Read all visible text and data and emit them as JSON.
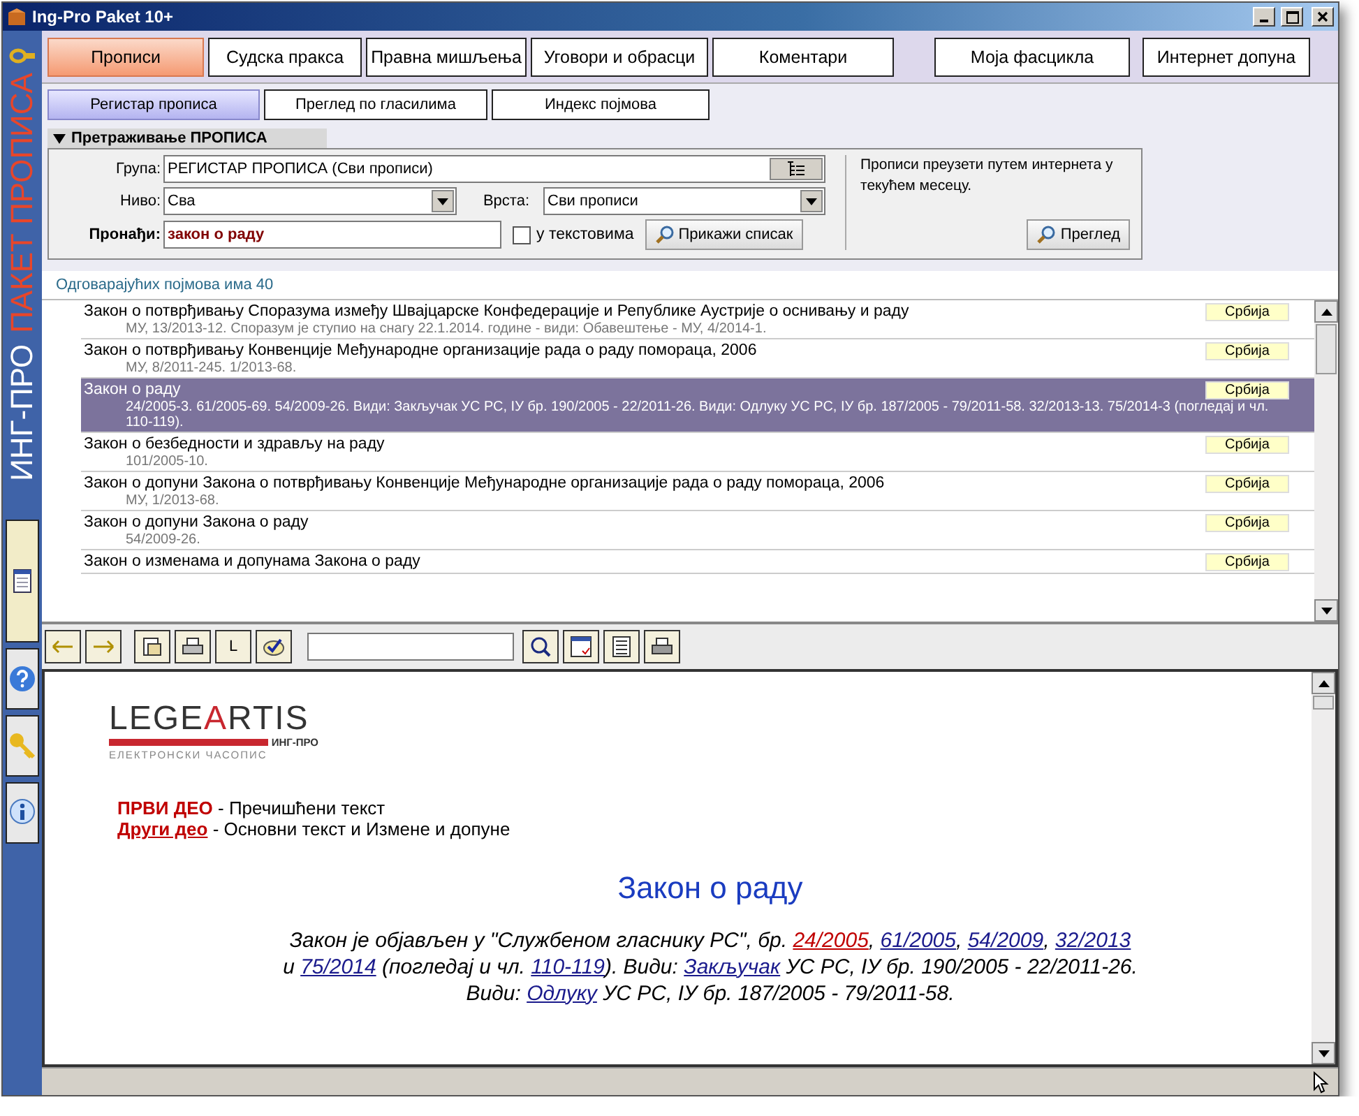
{
  "window": {
    "title": "Ing-Pro Paket 10+"
  },
  "brand": {
    "part_1": "ИНГ-ПРО",
    "part_2": "ПАКЕТ ПРОПИСА"
  },
  "tabs": [
    {
      "label": "Прописи",
      "selected": true
    },
    {
      "label": "Судска пракса",
      "selected": false
    },
    {
      "label": "Правна мишљења",
      "selected": false
    },
    {
      "label": "Уговори и обрасци",
      "selected": false
    },
    {
      "label": "Коментари",
      "selected": false
    },
    {
      "label": "Моја фасцикла",
      "selected": false
    },
    {
      "label": "Интернет допуна",
      "selected": false
    }
  ],
  "subtabs": [
    {
      "label": "Регистар прописа",
      "selected": true
    },
    {
      "label": "Преглед по гласилима",
      "selected": false
    },
    {
      "label": "Индекс појмова",
      "selected": false
    }
  ],
  "search": {
    "title": "Претраживање ПРОПИСА",
    "expanded": true,
    "group_label": "Група:",
    "group_value": "РЕГИСТАР ПРОПИСА (Сви прописи)",
    "level_label": "Ниво:",
    "level_value": "Сва",
    "type_label": "Врста:",
    "type_value": "Сви прописи",
    "find_label": "Пронађи:",
    "find_value": "закон о раду",
    "in_texts": {
      "label": "у текстовима",
      "checked": false
    },
    "show_button": "Прикажи списак",
    "note": "Прописи преузети путем интернета у текућем месецу.",
    "review_button": "Преглед"
  },
  "count": "Одговарајућих појмова има 40",
  "results": [
    {
      "title": "Закон о потврђивању Споразума између Швајцарске Конфедерације и Републике Аустрије о оснивању и раду",
      "details": "МУ, 13/2013-12. Споразум је ступио на снагу 22.1.2014. године - види: Обавештење - МУ, 4/2014-1.",
      "region": "Србија",
      "selected": false
    },
    {
      "title": "Закон о потврђивању Конвенције Међународне организације рада о раду помораца, 2006",
      "details": "МУ, 8/2011-245. 1/2013-68.",
      "region": "Србија",
      "selected": false
    },
    {
      "title": "Закон о раду",
      "details": "24/2005-3. 61/2005-69. 54/2009-26. Види: Закључак УС РС, IУ бр. 190/2005 - 22/2011-26. Види: Одлуку УС РС, IУ бр. 187/2005 - 79/2011-58. 32/2013-13. 75/2014-3 (погледај и чл. 110-119).",
      "region": "Србија",
      "selected": true
    },
    {
      "title": "Закон о безбедности и здрављу на раду",
      "details": "101/2005-10.",
      "region": "Србија",
      "selected": false
    },
    {
      "title": "Закон о допуни Закона о потврђивању Конвенције Међународне организације рада о раду помораца, 2006",
      "details": "МУ, 1/2013-68.",
      "region": "Србија",
      "selected": false
    },
    {
      "title": "Закон о допуни Закона о раду",
      "details": "54/2009-26.",
      "region": "Србија",
      "selected": false
    },
    {
      "title": "Закон о изменама и допунама Закона о раду",
      "region": "Србија",
      "selected": false
    }
  ],
  "toolbar": {
    "text_button": "L"
  },
  "document": {
    "logo": {
      "word_1": "LEGE",
      "word_2": "A",
      "word_3": "RTIS",
      "sub_1": "ИНГ-ПРО",
      "sub_2": "ЕЛЕКТРОНСКИ ЧАСОПИС"
    },
    "parts": [
      {
        "label": "ПРВИ ДЕО",
        "link": false,
        "desc": " - Пречишћени текст"
      },
      {
        "label": "Други део",
        "link": true,
        "desc": " - Основни текст и Измене и допуне"
      }
    ],
    "title": "Закон о раду",
    "lines": [
      [
        {
          "text": "Закон је објављен у \"Службеном гласнику РС\", бр. "
        },
        {
          "text": "24/2005",
          "link": true,
          "visited": true
        },
        {
          "text": ", "
        },
        {
          "text": "61/2005",
          "link": true,
          "visited": false
        },
        {
          "text": ", "
        },
        {
          "text": "54/2009",
          "link": true,
          "visited": false
        },
        {
          "text": ", "
        },
        {
          "text": "32/2013",
          "link": true,
          "visited": false
        }
      ],
      [
        {
          "text": "и "
        },
        {
          "text": "75/2014",
          "link": true,
          "visited": false
        },
        {
          "text": " (погледај и чл. "
        },
        {
          "text": "110-119",
          "link": true,
          "visited": false
        },
        {
          "text": "). Види: "
        },
        {
          "text": "Закључак",
          "link": true,
          "visited": false
        },
        {
          "text": " УС РС, IУ бр. 190/2005 - 22/2011-26."
        }
      ],
      [
        {
          "text": "Види: "
        },
        {
          "text": "Одлуку",
          "link": true,
          "visited": false
        },
        {
          "text": " УС РС, IУ бр. 187/2005 - 79/2011-58."
        }
      ]
    ]
  }
}
